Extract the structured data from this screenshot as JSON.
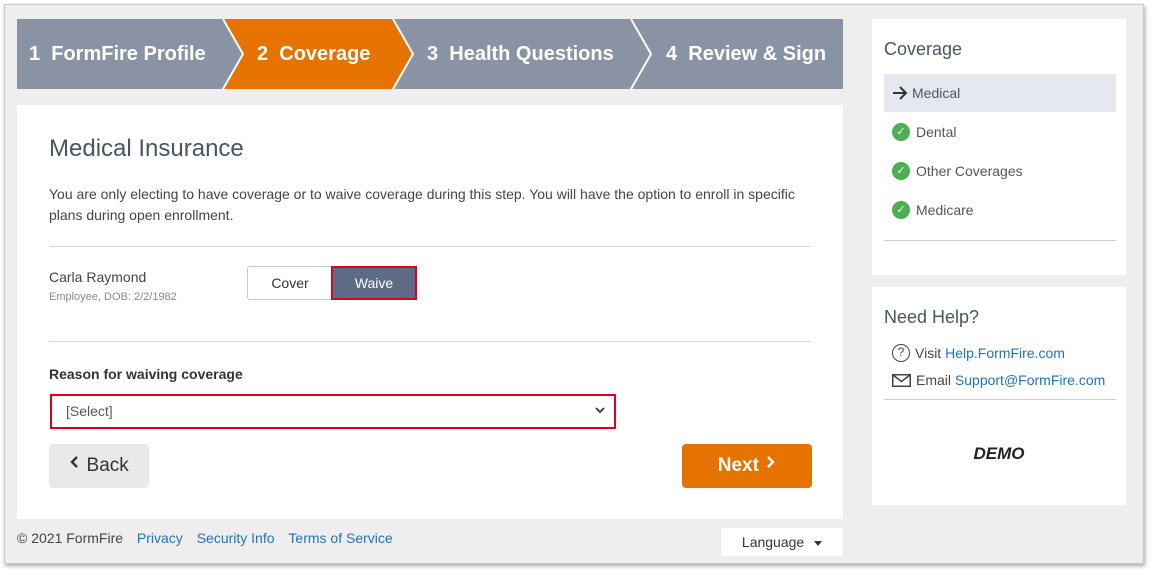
{
  "steps": [
    {
      "number": "1",
      "label": "FormFire Profile",
      "active": false
    },
    {
      "number": "2",
      "label": "Coverage",
      "active": true
    },
    {
      "number": "3",
      "label": "Health Questions",
      "active": false
    },
    {
      "number": "4",
      "label": "Review & Sign",
      "active": false
    }
  ],
  "colors": {
    "step_inactive": "#8a93a3",
    "step_active": "#e67200",
    "waive_selected": "#5d6b86",
    "highlight": "#e0001b",
    "link": "#1e73be"
  },
  "main": {
    "title": "Medical Insurance",
    "intro": "You are only electing to have coverage or to waive coverage during this step. You will have the option to enroll in specific plans during open enrollment.",
    "person": {
      "name": "Carla Raymond",
      "details": "Employee, DOB: 2/2/1982"
    },
    "cover_label": "Cover",
    "waive_label": "Waive",
    "selected_option": "Waive",
    "reason_label": "Reason for waiving coverage",
    "reason_select_value": "[Select]",
    "back_label": "Back",
    "next_label": "Next"
  },
  "footer": {
    "copyright": "© 2021 FormFire",
    "links": [
      "Privacy",
      "Security Info",
      "Terms of Service"
    ],
    "language_label": "Language"
  },
  "sidebar": {
    "coverage_title": "Coverage",
    "items": [
      {
        "label": "Medical",
        "status": "current",
        "icon": "arrow-right-icon"
      },
      {
        "label": "Dental",
        "status": "complete",
        "icon": "check-circle-icon"
      },
      {
        "label": "Other Coverages",
        "status": "complete",
        "icon": "check-circle-icon"
      },
      {
        "label": "Medicare",
        "status": "complete",
        "icon": "check-circle-icon"
      }
    ],
    "help_title": "Need Help?",
    "help_visit_prefix": "Visit",
    "help_visit_link": "Help.FormFire.com",
    "help_email_prefix": "Email",
    "help_email_link": "Support@FormFire.com",
    "demo_label": "DEMO"
  }
}
